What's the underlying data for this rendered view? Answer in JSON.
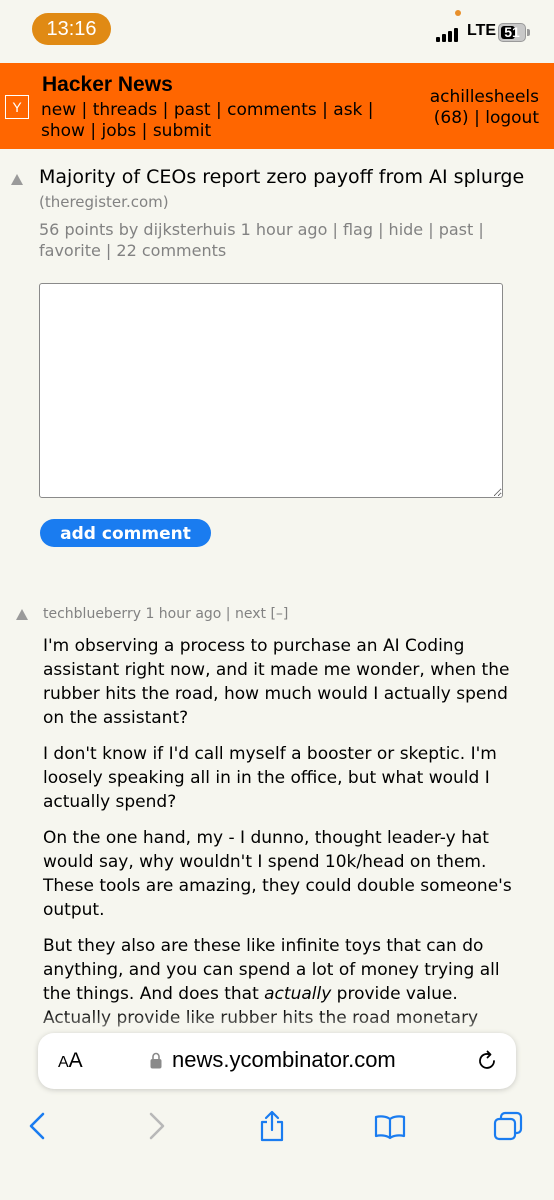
{
  "status_bar": {
    "time": "13:16",
    "network": "LTE",
    "battery": "51"
  },
  "header": {
    "logo": "Y",
    "title": "Hacker News",
    "nav": [
      "new",
      "threads",
      "past",
      "comments",
      "ask",
      "show",
      "jobs",
      "submit"
    ],
    "username": "achillesheels",
    "karma": "(68)",
    "logout": "logout"
  },
  "story": {
    "title": "Majority of CEOs report zero payoff from AI splurge",
    "site": "(theregister.com)",
    "points": "56 points",
    "by_label": "by",
    "author": "dijksterhuis",
    "age": "1 hour ago",
    "actions": [
      "flag",
      "hide",
      "past",
      "favorite"
    ],
    "comments": "22 comments"
  },
  "add_comment_label": "add comment",
  "comment": {
    "author": "techblueberry",
    "age": "1 hour ago",
    "next": "next",
    "toggle": "[–]",
    "paragraphs": [
      "I'm observing a process to purchase an AI Coding assistant right now, and it made me wonder, when the rubber hits the road, how much would I actually spend on the assistant?",
      "I don't know if I'd call myself a booster or skeptic. I'm loosely speaking all in in the office, but what would I actually spend?",
      "On the one hand, my - I dunno, thought leader-y hat would say, why wouldn't I spend 10k/head on them. These tools are amazing, they could double someone's output."
    ],
    "p4_before": "But they also are these like infinite toys that can do anything, and you can spend a lot of money trying all the things. And does that ",
    "p4_em": "actually",
    "p4_after": " provide value. Actually provide like rubber hits the road monetary value on a per-head basis. If you're really focused"
  },
  "browser": {
    "aa_small": "A",
    "aa_big": "A",
    "url": "news.ycombinator.com"
  },
  "colors": {
    "hn_orange": "#ff6600",
    "background": "#f6f6ef",
    "button_blue": "#1a7cf0",
    "muted_gray": "#828282",
    "toolbar_blue": "#1a7cf0"
  },
  "icons": [
    "lock-icon",
    "reload-icon",
    "back-icon",
    "forward-icon",
    "share-icon",
    "bookmarks-icon",
    "tabs-icon"
  ]
}
